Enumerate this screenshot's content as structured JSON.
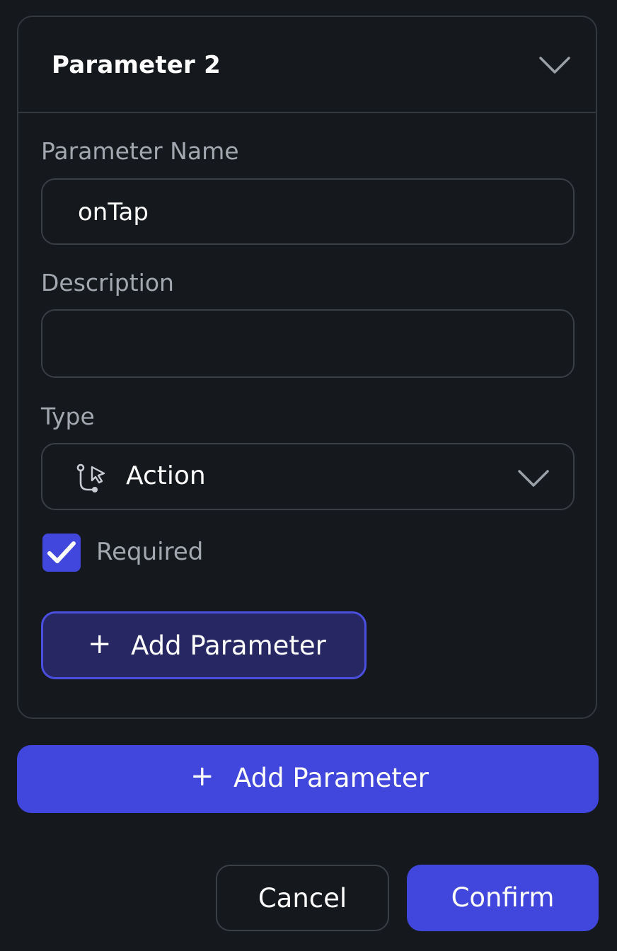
{
  "parameter_card": {
    "title": "Parameter 2",
    "name_label": "Parameter Name",
    "name_value": "onTap",
    "description_label": "Description",
    "description_value": "",
    "type_label": "Type",
    "type_value": "Action",
    "type_icon": "action-flow-icon",
    "required_label": "Required",
    "required_checked": true,
    "add_parameter_label": "Add Parameter"
  },
  "add_parameter_button": {
    "label": "Add Parameter"
  },
  "footer": {
    "cancel_label": "Cancel",
    "confirm_label": "Confirm"
  },
  "colors": {
    "background": "#15181c",
    "border": "#33373e",
    "accent": "#4146dc",
    "accent_dark": "#272863",
    "muted_text": "#a3a8b0"
  }
}
